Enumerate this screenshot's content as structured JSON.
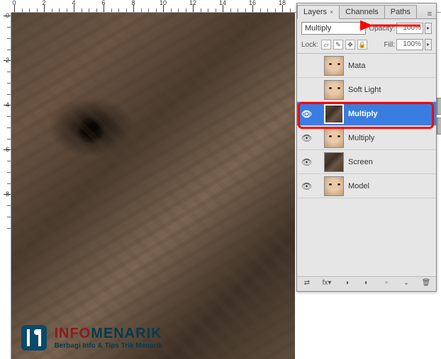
{
  "ruler": {
    "h_labels": [
      "0",
      "2",
      "4",
      "6",
      "8",
      "10",
      "12",
      "14",
      "16",
      "18"
    ],
    "v_labels": [
      "0",
      "2",
      "4",
      "6",
      "8"
    ]
  },
  "panel": {
    "tabs": [
      {
        "label": "Layers",
        "active": true,
        "closable": true
      },
      {
        "label": "Channels",
        "active": false,
        "closable": false
      },
      {
        "label": "Paths",
        "active": false,
        "closable": false
      }
    ],
    "blend_mode": "Multiply",
    "opacity_label": "Opacity:",
    "opacity_value": "100%",
    "lock_label": "Lock:",
    "fill_label": "Fill:",
    "fill_value": "100%",
    "layers": [
      {
        "name": "Mata",
        "visible": false,
        "thumb": "face",
        "selected": false
      },
      {
        "name": "Soft Light",
        "visible": false,
        "thumb": "face",
        "selected": false
      },
      {
        "name": "Multiply",
        "visible": true,
        "thumb": "bark",
        "selected": true
      },
      {
        "name": "Multiply",
        "visible": true,
        "thumb": "face",
        "selected": false
      },
      {
        "name": "Screen",
        "visible": true,
        "thumb": "bark",
        "selected": false
      },
      {
        "name": "Model",
        "visible": true,
        "thumb": "face",
        "selected": false
      }
    ],
    "lock_icons": [
      "▱",
      "✎",
      "✥",
      "🔒"
    ],
    "footer_icons": [
      "⇄",
      "fx▾",
      "◑",
      "◐",
      "▫",
      "⌄",
      "🗑"
    ]
  },
  "watermark": {
    "title_1": "INFO",
    "title_2": "MENARIK",
    "subtitle": "Berbagi Info & Tips Trik Menarik"
  },
  "annotations": {
    "highlight_layer_index": 2
  }
}
